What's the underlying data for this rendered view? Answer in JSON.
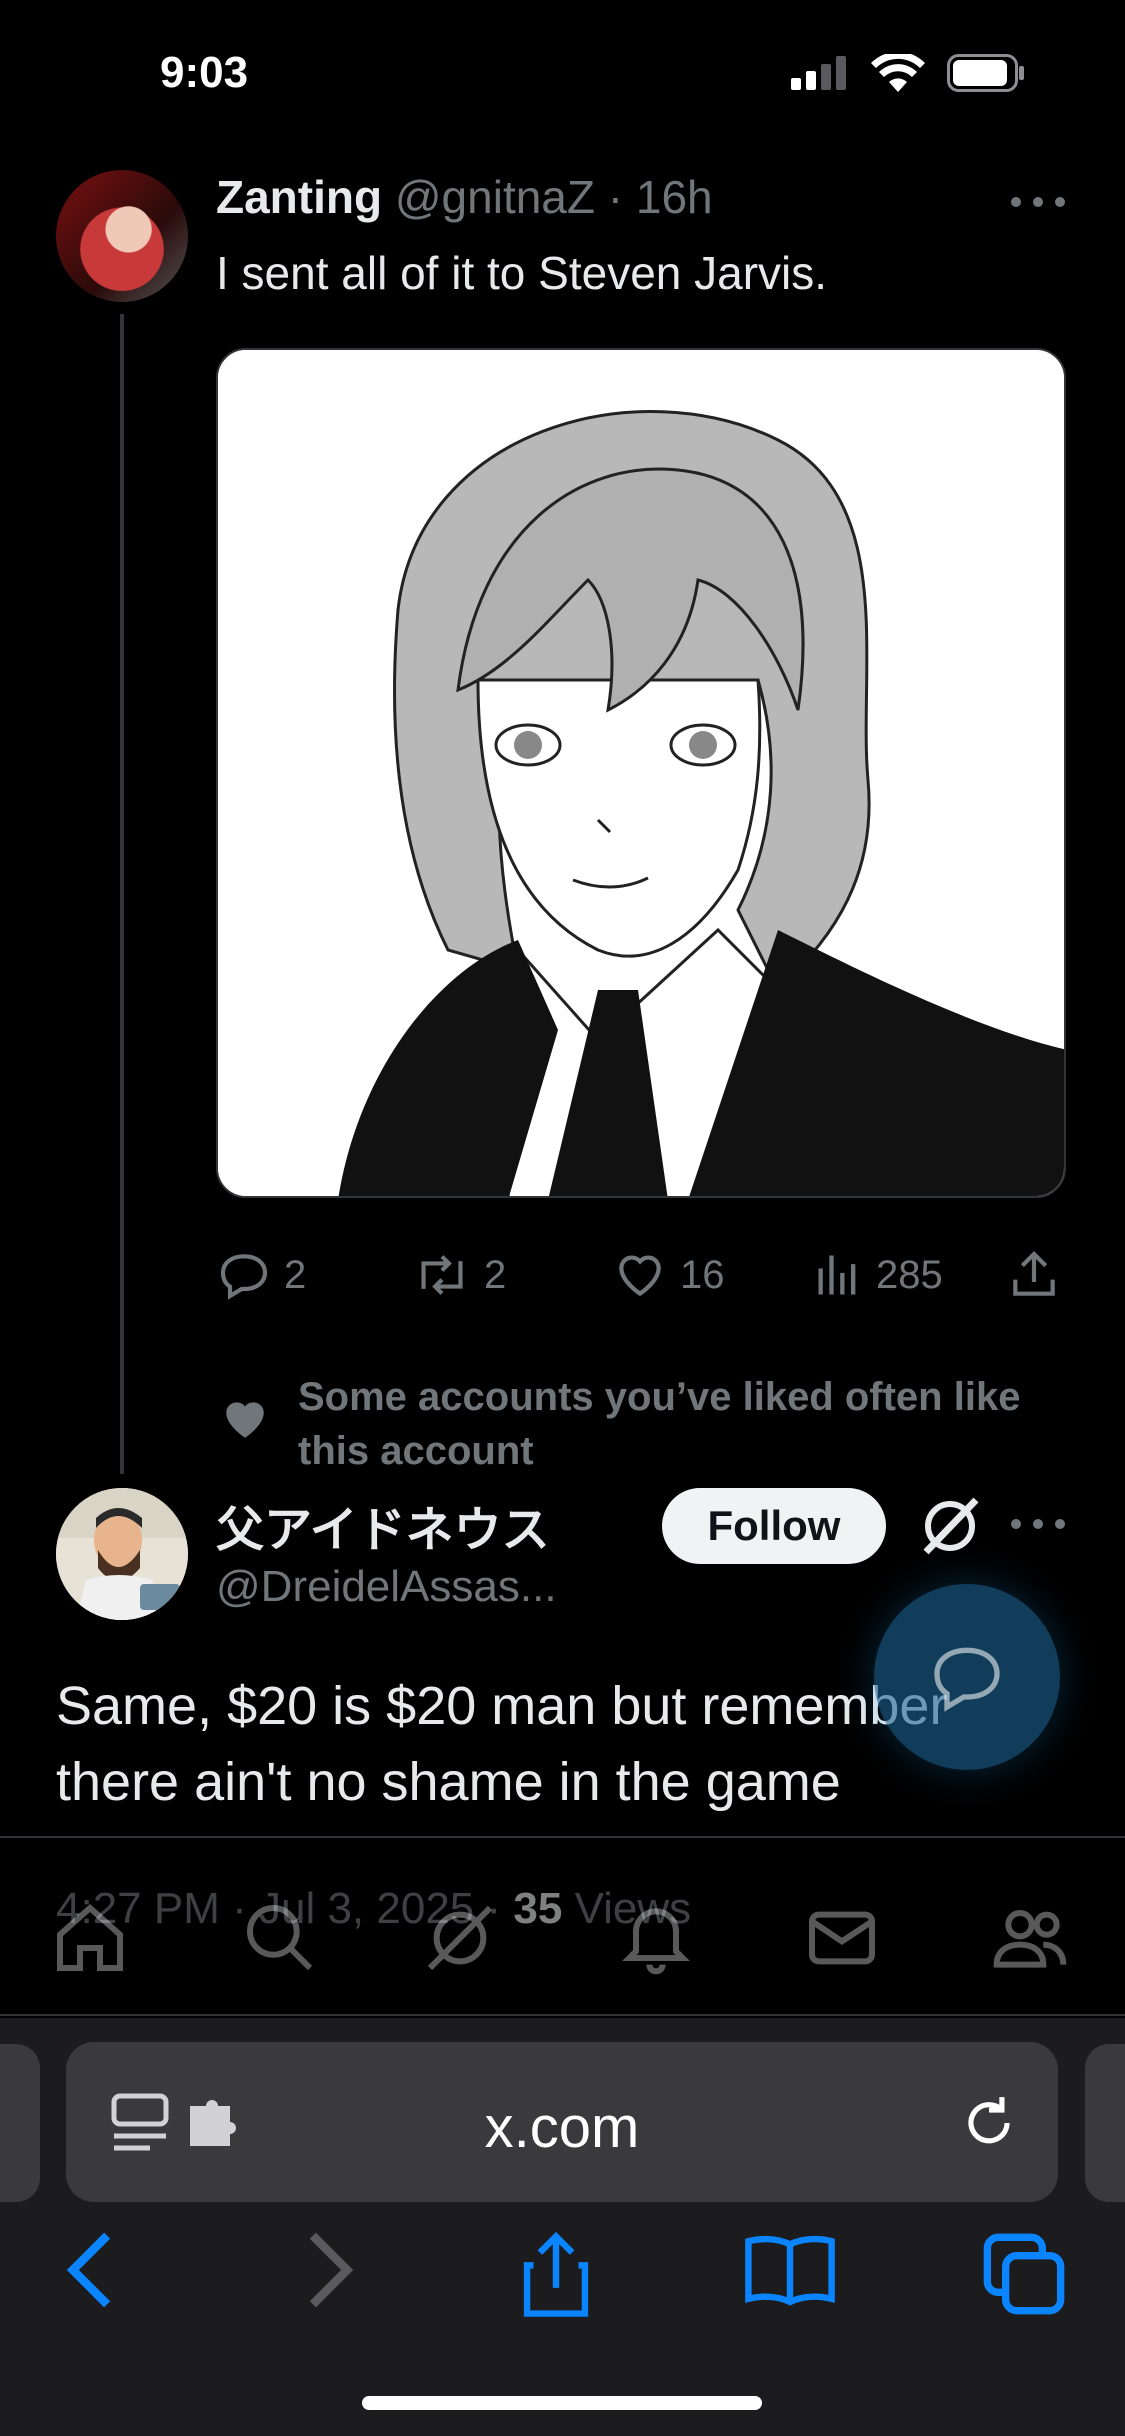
{
  "status_bar": {
    "time": "9:03",
    "icons": [
      "signal-icon",
      "wifi-icon",
      "battery-icon"
    ]
  },
  "tweet1": {
    "display_name": "Zanting",
    "handle": "@gnitnaZ",
    "separator": " · ",
    "age": "16h",
    "text": "I sent all of it to Steven Jarvis.",
    "media_description": "manga-portrait-image",
    "actions": {
      "replies": "2",
      "reposts": "2",
      "likes": "16",
      "views": "285"
    }
  },
  "social_context": {
    "text": "Some accounts you’ve liked often like this account"
  },
  "tweet2": {
    "display_name": "父アイドネウス",
    "handle": "@DreidelAssas...",
    "follow_label": "Follow",
    "text": "Same, $20 is $20 man but remember there ain't no shame in the game",
    "time": "4:27 PM",
    "date": "Jul 3, 2025",
    "views_count": "35",
    "views_label": "Views"
  },
  "safari": {
    "url": "x.com"
  },
  "colors": {
    "background": "#000000",
    "text_primary": "#e7e9ea",
    "text_secondary": "#71767b",
    "safari_accent": "#0a84ff",
    "follow_bg": "#eff3f4"
  }
}
